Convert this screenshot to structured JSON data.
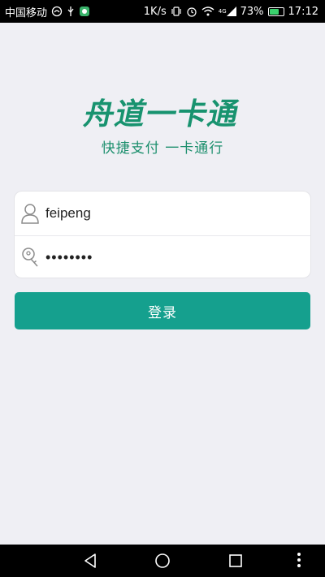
{
  "status_bar": {
    "carrier": "中国移动",
    "speed": "1K/s",
    "network": "4G",
    "battery_percent": "73%",
    "battery_level": 0.73,
    "time": "17:12"
  },
  "logo": {
    "title": "舟道一卡通",
    "slogan": "快捷支付 一卡通行",
    "color": "#18936f"
  },
  "form": {
    "username_value": "feipeng",
    "password_value": "••••••••"
  },
  "login_button": {
    "label": "登录",
    "color": "#15a08e"
  },
  "nav": {
    "back": "back-icon",
    "home": "home-icon",
    "recents": "recents-icon"
  }
}
